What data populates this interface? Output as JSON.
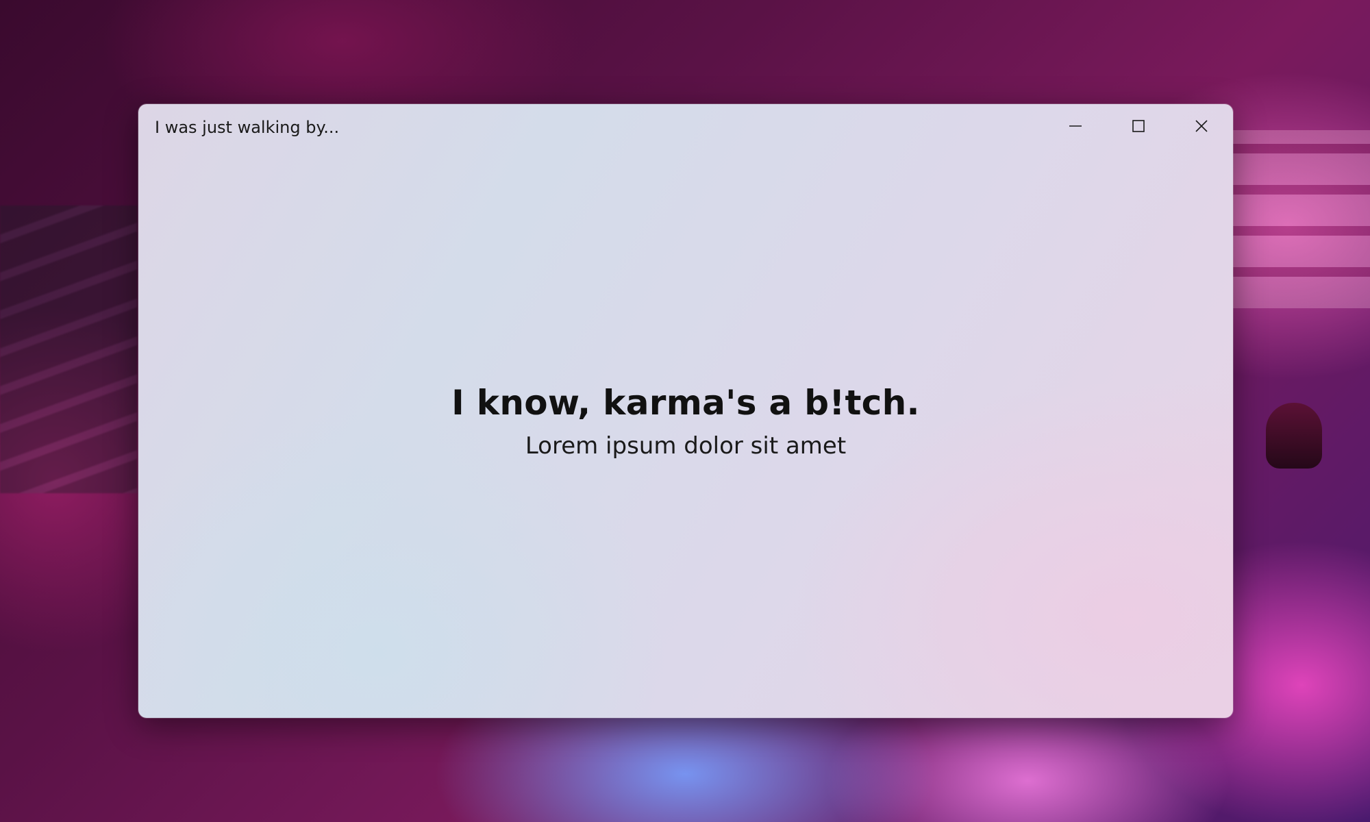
{
  "window": {
    "title": "I was just walking by...",
    "caption_buttons": {
      "minimize_icon": "minimize-icon",
      "maximize_icon": "maximize-icon",
      "close_icon": "close-icon"
    }
  },
  "content": {
    "headline": "I know, karma's a b!tch.",
    "subline": "Lorem ipsum dolor sit amet"
  },
  "colors": {
    "background_accent": "#7a1a5c",
    "window_tint": "#d4dcea",
    "text": "#111111"
  }
}
